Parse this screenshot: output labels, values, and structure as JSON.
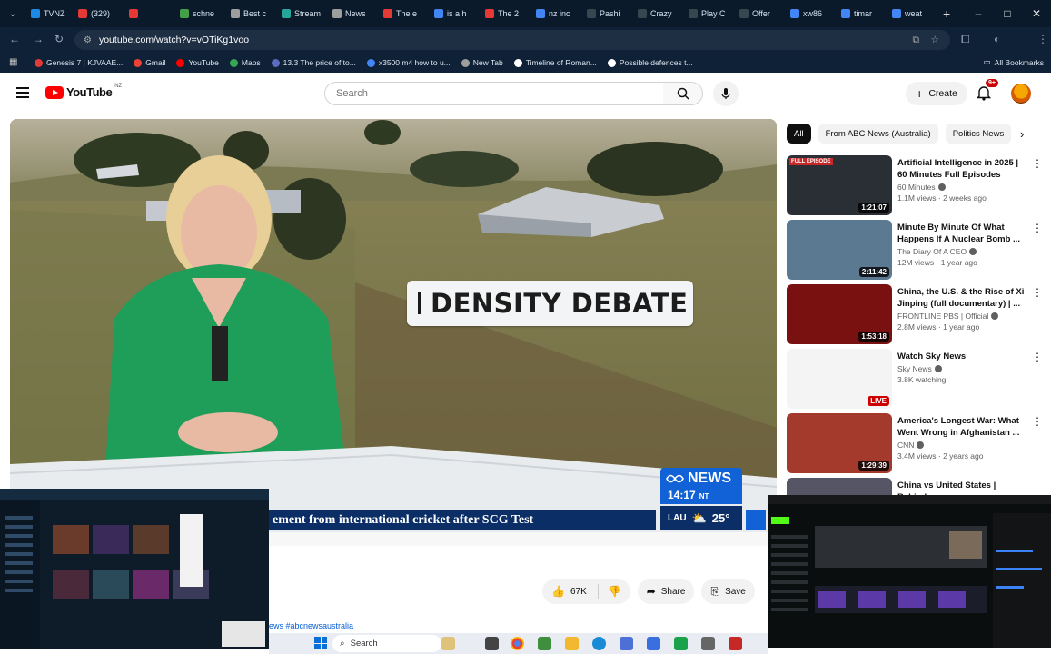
{
  "browser": {
    "tabs": [
      {
        "label": "TVNZ",
        "color": "#1e88e5"
      },
      {
        "label": "(329)",
        "color": "#e53935"
      },
      {
        "label": "",
        "color": "#e53935"
      },
      {
        "label": "schne",
        "color": "#43a047"
      },
      {
        "label": "Best c",
        "color": "#9e9e9e"
      },
      {
        "label": "Stream",
        "color": "#26a69a"
      },
      {
        "label": "News",
        "color": "#9e9e9e"
      },
      {
        "label": "The e",
        "color": "#e53935"
      },
      {
        "label": "is a h",
        "color": "#4285f4"
      },
      {
        "label": "The 2",
        "color": "#e53935"
      },
      {
        "label": "nz inc",
        "color": "#4285f4"
      },
      {
        "label": "Pashi",
        "color": "#37474f"
      },
      {
        "label": "Crazy",
        "color": "#37474f"
      },
      {
        "label": "Play C",
        "color": "#37474f"
      },
      {
        "label": "Offer",
        "color": "#37474f"
      },
      {
        "label": "xw86",
        "color": "#4285f4"
      },
      {
        "label": "timar",
        "color": "#4285f4"
      },
      {
        "label": "weat",
        "color": "#4285f4"
      }
    ],
    "new_tab": "+",
    "window_controls": {
      "minimize": "–",
      "maximize": "□",
      "close": "✕"
    },
    "url": "youtube.com/watch?v=vOTiKg1voo",
    "bookmarks": [
      {
        "label": "Genesis 7 | KJVAAE...",
        "color": "#e53935"
      },
      {
        "label": "Gmail",
        "color": "#ea4335"
      },
      {
        "label": "YouTube",
        "color": "#ff0000"
      },
      {
        "label": "Maps",
        "color": "#34a853"
      },
      {
        "label": "13.3 The price of to...",
        "color": "#5c6bc0"
      },
      {
        "label": "x3500 m4 how to u...",
        "color": "#4285f4"
      },
      {
        "label": "New Tab",
        "color": "#9e9e9e"
      },
      {
        "label": "Timeline of Roman...",
        "color": "#fff"
      },
      {
        "label": "Possible defences t...",
        "color": "#fff"
      }
    ],
    "all_bookmarks": "All Bookmarks"
  },
  "youtube": {
    "logo_text": "YouTube",
    "region": "NZ",
    "search_placeholder": "Search",
    "create_label": "Create",
    "notification_count": "9+"
  },
  "video": {
    "headline_box": "DENSITY DEBATE",
    "ticker": "ement from international cricket after SCG Test",
    "brand": "NEWS",
    "time": "14:17",
    "timezone": "NT",
    "weather_place": "LAU",
    "temperature": "25°"
  },
  "chips": [
    "All",
    "From ABC News (Australia)",
    "Politics News"
  ],
  "recommendations": [
    {
      "title": "Artificial Intelligence in 2025 | 60 Minutes Full Episodes",
      "channel": "60 Minutes",
      "meta": "1.1M views · 2 weeks ago",
      "duration": "1:21:07",
      "badge": "FULL EPISODE",
      "thumb_color": "#2a2f36"
    },
    {
      "title": "Minute By Minute Of What Happens If A Nuclear Bomb ...",
      "channel": "The Diary Of A CEO",
      "meta": "12M views · 1 year ago",
      "duration": "2:11:42",
      "badge": "",
      "thumb_color": "#5b7a91"
    },
    {
      "title": "China, the U.S. & the Rise of Xi Jinping (full documentary) | ...",
      "channel": "FRONTLINE PBS | Official",
      "meta": "2.8M views · 1 year ago",
      "duration": "1:53:18",
      "badge": "",
      "thumb_color": "#7a1111"
    },
    {
      "title": "Watch Sky News",
      "channel": "Sky News",
      "meta": "3.8K watching",
      "duration": "LIVE",
      "badge": "",
      "thumb_color": "#f4f4f4"
    },
    {
      "title": "America's Longest War: What Went Wrong in Afghanistan ...",
      "channel": "CNN",
      "meta": "3.4M views · 2 years ago",
      "duration": "1:29:39",
      "badge": "",
      "thumb_color": "#a43a2c"
    },
    {
      "title": "China vs United States | Behind",
      "channel": "",
      "meta": "",
      "duration": "",
      "badge": "",
      "thumb_color": "#556"
    }
  ],
  "actions": {
    "likes": "67K",
    "share": "Share",
    "save": "Save"
  },
  "hashtag": "ews #abcnewsaustralia",
  "taskbar": {
    "search": "Search"
  }
}
